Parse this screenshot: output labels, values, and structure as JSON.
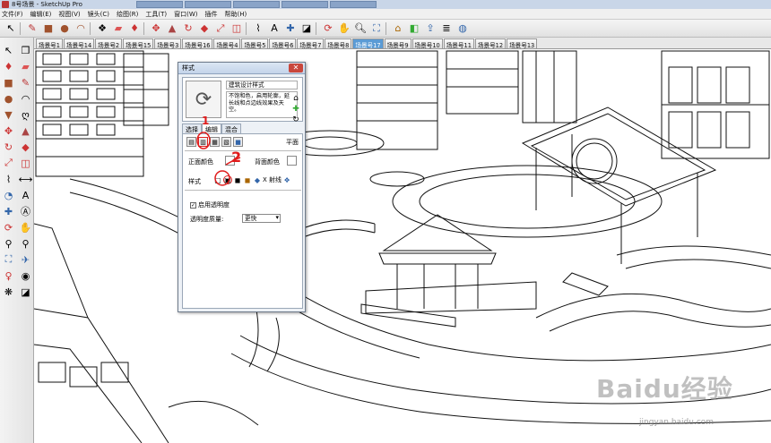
{
  "window": {
    "title": "8号场景 - SketchUp Pro"
  },
  "menu": [
    "文件(F)",
    "编辑(E)",
    "视图(V)",
    "镜头(C)",
    "绘图(R)",
    "工具(T)",
    "窗口(W)",
    "插件",
    "帮助(H)"
  ],
  "scene_tabs": [
    "场景号1",
    "场景号14",
    "场景号2",
    "场景号15",
    "场景号3",
    "场景号16",
    "场景号4",
    "场景号5",
    "场景号6",
    "场景号7",
    "场景号8",
    "场景号17",
    "场景号9",
    "场景号10",
    "场景号11",
    "场景号12",
    "场景号13"
  ],
  "active_scene": "场景号17",
  "dialog": {
    "title": "样式",
    "close": "✕",
    "style_name": "建筑设计样式",
    "style_desc": "不饱和色，启用轮廓，延长线和点边线效果及天空。",
    "tabs": [
      "选择",
      "编辑",
      "混合"
    ],
    "active_tab": "编辑",
    "category_label": "平面",
    "front_color_label": "正面颜色",
    "back_color_label": "背面颜色",
    "style_label": "样式",
    "xray_label": "X 射线",
    "enable_transparency": "启用透明度",
    "transparency_quality_label": "透明度质量:",
    "transparency_quality_value": "更快"
  },
  "annotations": {
    "one": "1",
    "two": "2"
  },
  "watermark": {
    "logo": "Baidu经验",
    "url": "jingyan.baidu.com"
  },
  "icons": {
    "toolbar": [
      "select-icon",
      "pencil-icon",
      "rectangle-icon",
      "circle-icon",
      "eraser-icon",
      "paint-icon",
      "pushpull-icon",
      "move-icon",
      "rotate-icon",
      "offset-icon",
      "tape-icon",
      "orbit-icon",
      "pan-icon",
      "zoom-icon",
      "zoom-extents-icon",
      "house-icon",
      "layers-icon"
    ],
    "colors": {
      "active_tab": "#5b9bd5",
      "annotation": "#e01b1b"
    }
  }
}
